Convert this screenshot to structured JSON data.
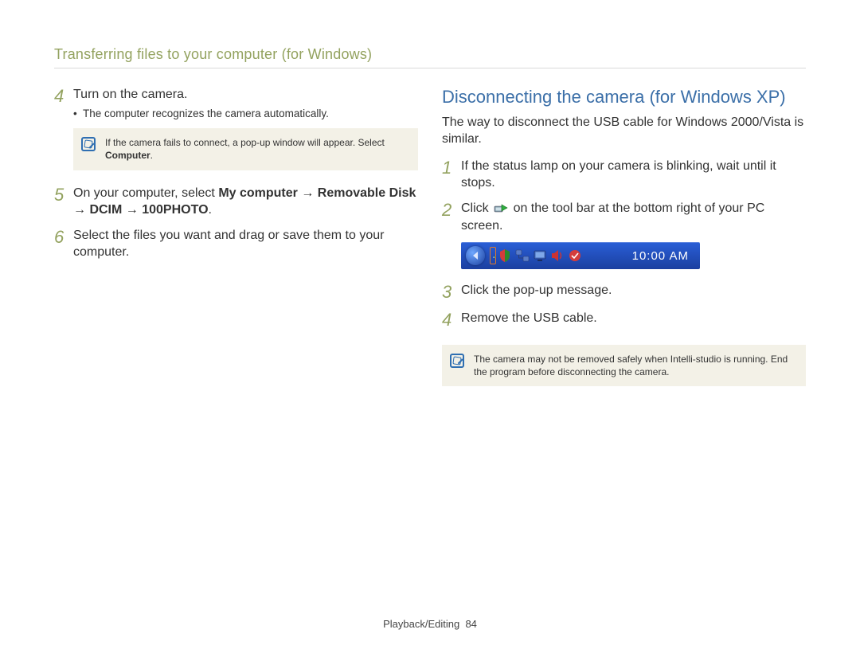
{
  "header": {
    "title": "Transferring files to your computer (for Windows)"
  },
  "left": {
    "steps": [
      {
        "num": "4",
        "text": "Turn on the camera.",
        "bullet": "The computer recognizes the camera automatically.",
        "note_plain": "If the camera fails to connect, a pop-up window will appear. Select ",
        "note_bold": "Computer",
        "note_tail": "."
      },
      {
        "num": "5",
        "text_lead": "On your computer, select ",
        "text_bold": "My computer → Removable Disk → DCIM → 100PHOTO",
        "text_tail": "."
      },
      {
        "num": "6",
        "text": "Select the files you want and drag or save them to your computer."
      }
    ]
  },
  "right": {
    "title": "Disconnecting the camera (for Windows XP)",
    "intro": "The way to disconnect the USB cable for Windows 2000/Vista is similar.",
    "steps": [
      {
        "num": "1",
        "text": "If the status lamp on your camera is blinking, wait until it stops."
      },
      {
        "num": "2",
        "text_a": "Click ",
        "text_b": " on the tool bar at the bottom right of your PC screen.",
        "icon": "safely-remove-hardware-icon"
      },
      {
        "num": "3",
        "text": "Click the pop-up message."
      },
      {
        "num": "4",
        "text": "Remove the USB cable."
      }
    ],
    "tray": {
      "time": "10:00 AM",
      "icons": [
        "safely-remove-hardware-icon",
        "security-icon",
        "network-icon",
        "display-icon",
        "volume-icon",
        "antivirus-icon"
      ]
    },
    "note": "The camera may not be removed safely when Intelli-studio is running. End the program before disconnecting the camera."
  },
  "footer": {
    "section": "Playback/Editing",
    "page": "84"
  }
}
